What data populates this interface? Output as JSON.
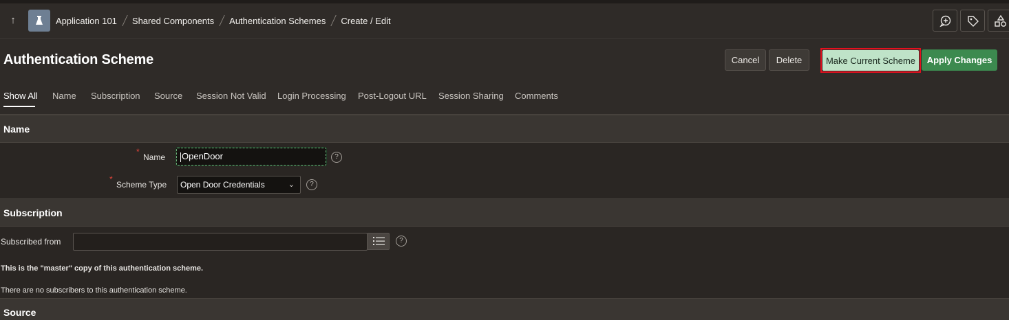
{
  "breadcrumb": {
    "up_icon": "arrow-up-icon",
    "items": [
      "Application 101",
      "Shared Components",
      "Authentication Schemes",
      "Create / Edit"
    ]
  },
  "toolbar": {
    "icons": [
      "comment-add-icon",
      "tag-icon",
      "shapes-icon"
    ]
  },
  "header": {
    "title": "Authentication Scheme",
    "cancel_label": "Cancel",
    "delete_label": "Delete",
    "make_current_label": "Make Current Scheme",
    "apply_label": "Apply Changes"
  },
  "tabs": [
    {
      "label": "Show All",
      "active": true
    },
    {
      "label": "Name"
    },
    {
      "label": "Subscription"
    },
    {
      "label": "Source"
    },
    {
      "label": "Session Not Valid"
    },
    {
      "label": "Login Processing"
    },
    {
      "label": "Post-Logout URL"
    },
    {
      "label": "Session Sharing"
    },
    {
      "label": "Comments"
    }
  ],
  "name_region": {
    "title": "Name",
    "name_label": "Name",
    "name_value": "OpenDoor",
    "scheme_type_label": "Scheme Type",
    "scheme_type_value": "Open Door Credentials"
  },
  "subscription_region": {
    "title": "Subscription",
    "subscribed_from_label": "Subscribed from",
    "subscribed_from_value": "",
    "master_note": "This is the \"master\" copy of this authentication scheme.",
    "subscribers_note": "There are no subscribers to this authentication scheme."
  },
  "source_region": {
    "title": "Source"
  },
  "colors": {
    "accent_green": "#3c8a4f",
    "make_current_bg": "#bfe3c8",
    "highlight_red": "#e3101e",
    "required_red": "#e0443a"
  }
}
